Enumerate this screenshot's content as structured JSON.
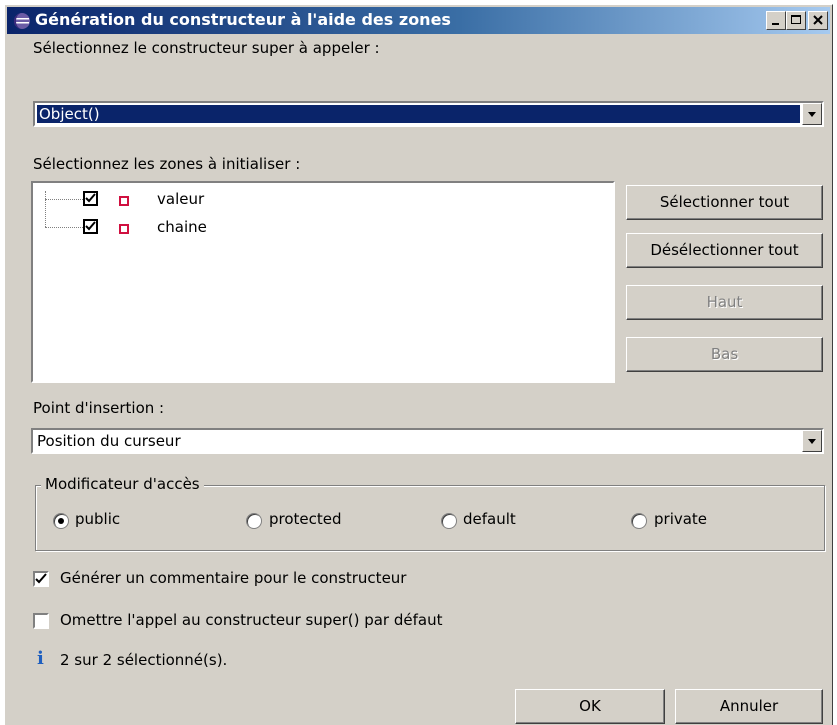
{
  "window": {
    "title": "Génération du constructeur à l'aide des zones",
    "minimize_icon": "minimize-icon",
    "maximize_icon": "maximize-icon",
    "close_icon": "close-icon"
  },
  "super_constructor": {
    "label": "Sélectionnez le constructeur super à appeler :",
    "selected": "Object()"
  },
  "fields": {
    "label": "Sélectionnez les zones à initialiser :",
    "items": [
      {
        "name": "valeur",
        "checked": true
      },
      {
        "name": "chaine",
        "checked": true
      }
    ]
  },
  "side_buttons": {
    "select_all": "Sélectionner tout",
    "deselect_all": "Désélectionner tout",
    "up": "Haut",
    "down": "Bas"
  },
  "insertion_point": {
    "label": "Point d'insertion :",
    "selected": "Position du curseur"
  },
  "access_modifier": {
    "title": "Modificateur d'accès",
    "options": [
      {
        "label": "public",
        "selected": true
      },
      {
        "label": "protected",
        "selected": false
      },
      {
        "label": "default",
        "selected": false
      },
      {
        "label": "private",
        "selected": false
      }
    ]
  },
  "options": {
    "generate_comment": {
      "label": "Générer un commentaire pour le constructeur",
      "checked": true
    },
    "omit_super": {
      "label": "Omettre l'appel au constructeur super() par défaut",
      "checked": false
    }
  },
  "status": {
    "icon": "info-icon",
    "text": "2 sur 2 sélectionné(s)."
  },
  "footer": {
    "ok": "OK",
    "cancel": "Annuler"
  },
  "colors": {
    "title_gradient_start": "#0a246a",
    "title_gradient_end": "#a6caf0",
    "dialog_bg": "#d4d0c8",
    "selection": "#0a246a",
    "field_icon": "#d01040"
  }
}
